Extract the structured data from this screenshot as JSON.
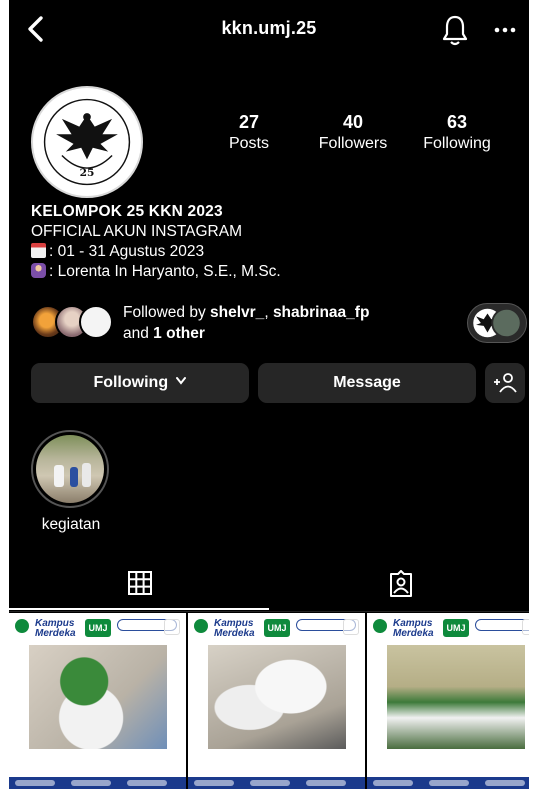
{
  "header": {
    "username": "kkn.umj.25"
  },
  "stats": [
    {
      "value": "27",
      "label": "Posts"
    },
    {
      "value": "40",
      "label": "Followers"
    },
    {
      "value": "63",
      "label": "Following"
    }
  ],
  "bio": {
    "name": "KELOMPOK 25 KKN 2023",
    "line1": "OFFICIAL AKUN INSTAGRAM",
    "line2": ": 01 - 31 Agustus 2023",
    "line3": ": Lorenta In Haryanto, S.E., M.Sc."
  },
  "followed_by": {
    "prefix": "Followed by ",
    "user1": "shelvr_",
    "sep": ", ",
    "user2": "shabrinaa_fp",
    "and": "and ",
    "others": "1 other"
  },
  "buttons": {
    "following": "Following",
    "message": "Message"
  },
  "highlight": {
    "label": "kegiatan"
  },
  "colors": {
    "background": "#000000",
    "button": "#262626",
    "brand_blue": "#1b3a8c",
    "brand_green": "#0e8a3c"
  },
  "icons": [
    "chevron-left-icon",
    "bell-icon",
    "more-icon",
    "chevron-down-icon",
    "add-person-icon",
    "grid-icon",
    "tagged-icon"
  ]
}
